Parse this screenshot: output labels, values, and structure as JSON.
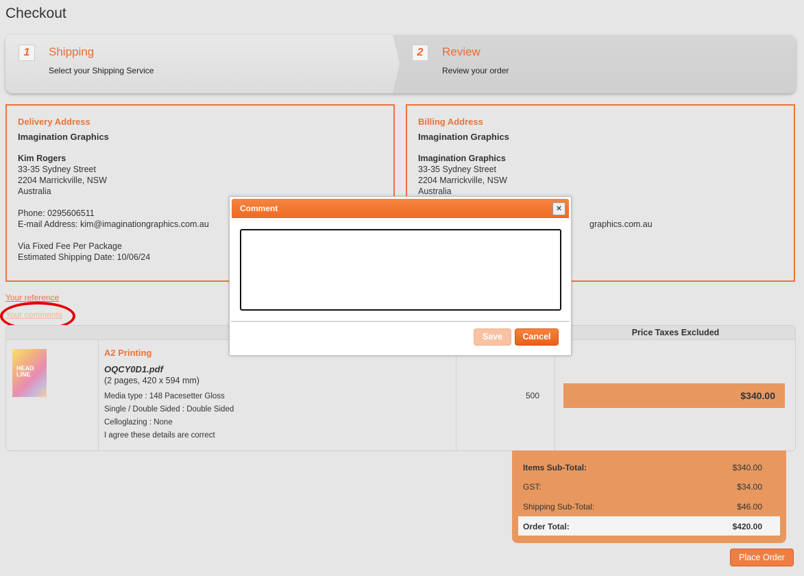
{
  "page": {
    "title": "Checkout"
  },
  "steps": [
    {
      "number": "1",
      "title": "Shipping",
      "subtitle": "Select your Shipping Service"
    },
    {
      "number": "2",
      "title": "Review",
      "subtitle": "Review your order"
    }
  ],
  "delivery": {
    "heading": "Delivery Address",
    "company": "Imagination Graphics",
    "name": "Kim Rogers",
    "street": "33-35 Sydney Street",
    "city": "2204 Marrickville, NSW",
    "country": "Australia",
    "phone": "Phone: 0295606511",
    "email": "E-mail Address: kim@imaginationgraphics.com.au",
    "shipping_method": "Via Fixed Fee Per Package",
    "shipping_date": "Estimated Shipping Date: 10/06/24"
  },
  "billing": {
    "heading": "Billing Address",
    "company": "Imagination Graphics",
    "name": "Imagination Graphics",
    "street": "33-35 Sydney Street",
    "city": "2204 Marrickville, NSW",
    "country": "Australia",
    "email_fragment": "graphics.com.au"
  },
  "links": {
    "reference": "Your reference",
    "comments": "Your comments"
  },
  "table": {
    "price_header": "Price Taxes Excluded",
    "item": {
      "thumb_text": "HEAD LINE",
      "title": "A2 Printing",
      "file": "OQCY0D1.pdf",
      "pages": "(2 pages, 420 x 594 mm)",
      "attributes": [
        "Media type : 148 Pacesetter Gloss",
        "Single / Double Sided : Double Sided",
        "Celloglazing : None",
        "I agree these details are correct"
      ],
      "quantity": "500",
      "price": "$340.00"
    }
  },
  "totals": {
    "items_subtotal_label": "Items Sub-Total:",
    "items_subtotal": "$340.00",
    "gst_label": "GST:",
    "gst": "$34.00",
    "shipping_label": "Shipping Sub-Total:",
    "shipping": "$46.00",
    "order_total_label": "Order Total:",
    "order_total": "$420.00"
  },
  "place_order_label": "Place Order",
  "dialog": {
    "title": "Comment",
    "close_glyph": "×",
    "textarea_value": "",
    "save_label": "Save",
    "cancel_label": "Cancel"
  },
  "colors": {
    "accent": "#e8743b",
    "summary_fill": "#e8985f",
    "highlight_circle": "#e30000"
  }
}
